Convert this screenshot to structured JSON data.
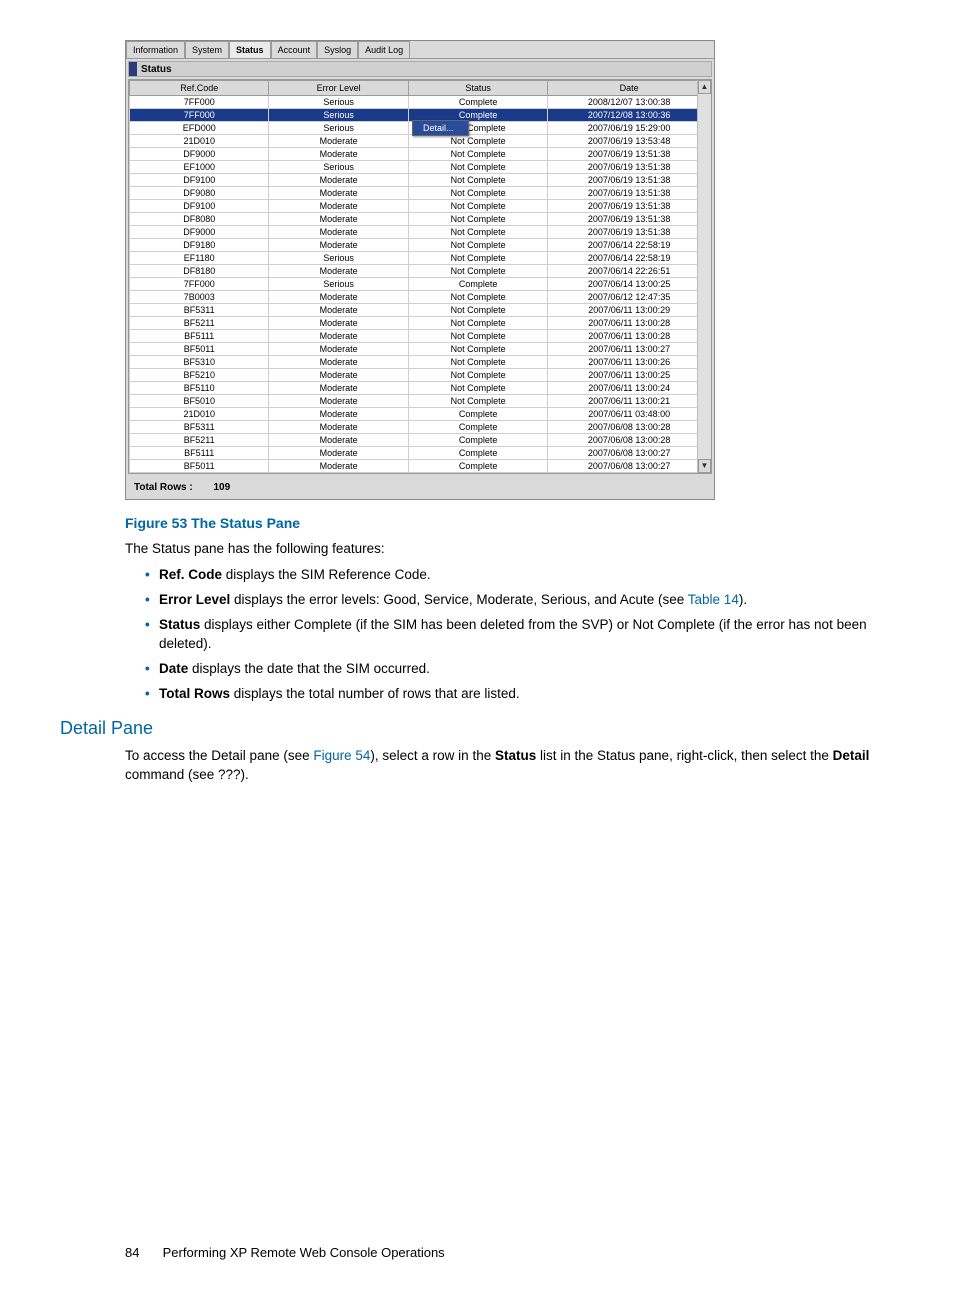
{
  "tabs": [
    "Information",
    "System",
    "Status",
    "Account",
    "Syslog",
    "Audit Log"
  ],
  "activeTab": "Status",
  "paneTitle": "Status",
  "columns": [
    "Ref.Code",
    "Error Level",
    "Status",
    "Date"
  ],
  "selectedIndex": 1,
  "contextMenu": {
    "item": "Detail..."
  },
  "rows": [
    {
      "ref": "7FF000",
      "level": "Serious",
      "status": "Complete",
      "date": "2008/12/07 13:00:38"
    },
    {
      "ref": "7FF000",
      "level": "Serious",
      "status": "Complete",
      "date": "2007/12/08 13:00:36"
    },
    {
      "ref": "EFD000",
      "level": "Serious",
      "status": "Not Complete",
      "date": "2007/06/19 15:29:00"
    },
    {
      "ref": "21D010",
      "level": "Moderate",
      "status": "Not Complete",
      "date": "2007/06/19 13:53:48"
    },
    {
      "ref": "DF9000",
      "level": "Moderate",
      "status": "Not Complete",
      "date": "2007/06/19 13:51:38"
    },
    {
      "ref": "EF1000",
      "level": "Serious",
      "status": "Not Complete",
      "date": "2007/06/19 13:51:38"
    },
    {
      "ref": "DF9100",
      "level": "Moderate",
      "status": "Not Complete",
      "date": "2007/06/19 13:51:38"
    },
    {
      "ref": "DF9080",
      "level": "Moderate",
      "status": "Not Complete",
      "date": "2007/06/19 13:51:38"
    },
    {
      "ref": "DF9100",
      "level": "Moderate",
      "status": "Not Complete",
      "date": "2007/06/19 13:51:38"
    },
    {
      "ref": "DF8080",
      "level": "Moderate",
      "status": "Not Complete",
      "date": "2007/06/19 13:51:38"
    },
    {
      "ref": "DF9000",
      "level": "Moderate",
      "status": "Not Complete",
      "date": "2007/06/19 13:51:38"
    },
    {
      "ref": "DF9180",
      "level": "Moderate",
      "status": "Not Complete",
      "date": "2007/06/14 22:58:19"
    },
    {
      "ref": "EF1180",
      "level": "Serious",
      "status": "Not Complete",
      "date": "2007/06/14 22:58:19"
    },
    {
      "ref": "DF8180",
      "level": "Moderate",
      "status": "Not Complete",
      "date": "2007/06/14 22:26:51"
    },
    {
      "ref": "7FF000",
      "level": "Serious",
      "status": "Complete",
      "date": "2007/06/14 13:00:25"
    },
    {
      "ref": "7B0003",
      "level": "Moderate",
      "status": "Not Complete",
      "date": "2007/06/12 12:47:35"
    },
    {
      "ref": "BF5311",
      "level": "Moderate",
      "status": "Not Complete",
      "date": "2007/06/11 13:00:29"
    },
    {
      "ref": "BF5211",
      "level": "Moderate",
      "status": "Not Complete",
      "date": "2007/06/11 13:00:28"
    },
    {
      "ref": "BF5111",
      "level": "Moderate",
      "status": "Not Complete",
      "date": "2007/06/11 13:00:28"
    },
    {
      "ref": "BF5011",
      "level": "Moderate",
      "status": "Not Complete",
      "date": "2007/06/11 13:00:27"
    },
    {
      "ref": "BF5310",
      "level": "Moderate",
      "status": "Not Complete",
      "date": "2007/06/11 13:00:26"
    },
    {
      "ref": "BF5210",
      "level": "Moderate",
      "status": "Not Complete",
      "date": "2007/06/11 13:00:25"
    },
    {
      "ref": "BF5110",
      "level": "Moderate",
      "status": "Not Complete",
      "date": "2007/06/11 13:00:24"
    },
    {
      "ref": "BF5010",
      "level": "Moderate",
      "status": "Not Complete",
      "date": "2007/06/11 13:00:21"
    },
    {
      "ref": "21D010",
      "level": "Moderate",
      "status": "Complete",
      "date": "2007/06/11 03:48:00"
    },
    {
      "ref": "BF5311",
      "level": "Moderate",
      "status": "Complete",
      "date": "2007/06/08 13:00:28"
    },
    {
      "ref": "BF5211",
      "level": "Moderate",
      "status": "Complete",
      "date": "2007/06/08 13:00:28"
    },
    {
      "ref": "BF5111",
      "level": "Moderate",
      "status": "Complete",
      "date": "2007/06/08 13:00:27"
    },
    {
      "ref": "BF5011",
      "level": "Moderate",
      "status": "Complete",
      "date": "2007/06/08 13:00:27"
    }
  ],
  "totalRowsLabel": "Total Rows :",
  "totalRowsValue": "109",
  "figureCaption": "Figure 53 The Status Pane",
  "introText": "The Status pane has the following features:",
  "features": {
    "ref": {
      "term": "Ref. Code",
      "desc": " displays the SIM Reference Code."
    },
    "err": {
      "term": "Error Level",
      "desc_before": " displays the error levels: Good, Service, Moderate, Serious, and Acute (see ",
      "link": "Table 14",
      "desc_after": ")."
    },
    "status": {
      "term": "Status",
      "desc": " displays either Complete (if the SIM has been deleted from the SVP) or Not Complete (if the error has not been deleted)."
    },
    "date": {
      "term": "Date",
      "desc": " displays the date that the SIM occurred."
    },
    "total": {
      "term": "Total Rows",
      "desc": " displays the total number of rows that are listed."
    }
  },
  "detailHeading": "Detail Pane",
  "detailPara": {
    "p1": "To access the Detail pane (see ",
    "link": "Figure 54",
    "p2": "), select a row in the ",
    "bold1": "Status",
    "p3": " list in the Status pane, right-click, then select the ",
    "bold2": "Detail",
    "p4": " command (see ???)."
  },
  "footer": {
    "page": "84",
    "text": "Performing XP Remote Web Console Operations"
  }
}
